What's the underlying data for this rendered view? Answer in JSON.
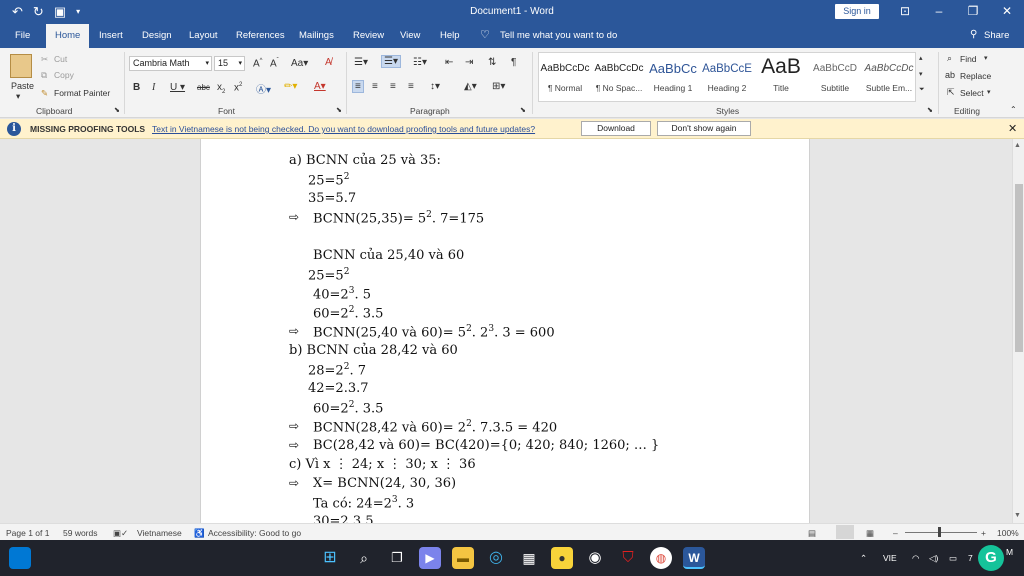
{
  "title_bar": {
    "doc_title": "Document1  -  Word",
    "sign_in": "Sign in"
  },
  "tabs": [
    "File",
    "Home",
    "Insert",
    "Design",
    "Layout",
    "References",
    "Mailings",
    "Review",
    "View",
    "Help"
  ],
  "tell_me": "Tell me what you want to do",
  "share": "Share",
  "clipboard": {
    "paste": "Paste",
    "cut": "Cut",
    "copy": "Copy",
    "format_painter": "Format Painter",
    "label": "Clipboard"
  },
  "font": {
    "name": "Cambria Math",
    "size": "15",
    "label": "Font"
  },
  "paragraph": {
    "label": "Paragraph"
  },
  "styles": {
    "label": "Styles",
    "items": [
      {
        "preview": "AaBbCcDc",
        "name": "¶ Normal"
      },
      {
        "preview": "AaBbCcDc",
        "name": "¶ No Spac..."
      },
      {
        "preview": "AaBbCc",
        "name": "Heading 1"
      },
      {
        "preview": "AaBbCcE",
        "name": "Heading 2"
      },
      {
        "preview": "AaB",
        "name": "Title"
      },
      {
        "preview": "AaBbCcD",
        "name": "Subtitle"
      },
      {
        "preview": "AaBbCcDc",
        "name": "Subtle Em..."
      }
    ]
  },
  "editing": {
    "find": "Find",
    "replace": "Replace",
    "select": "Select",
    "label": "Editing"
  },
  "infobar": {
    "title": "MISSING PROOFING TOOLS",
    "message": "Text in Vietnamese is not being checked. Do you want to download proofing tools and future updates?",
    "download": "Download",
    "dont_show": "Don't show again"
  },
  "document": {
    "lines": [
      "a) BCNN của 25 và 35:",
      "25=5",
      "35=5.7",
      "BCNN(25,35)= 5",
      "BCNN của 25,40 và 60",
      "25=5",
      "40=2",
      "60=2",
      "BCNN(25,40 và 60)= 5",
      "b) BCNN của 28,42 và 60",
      "28=2",
      "42=2.3.7",
      "60=2",
      "BCNN(28,42 và 60)= 2",
      "BC(28,42 và 60)= BC(420)={0; 420; 840; 1260; … }",
      "c) Vì x ⋮ 24; x ⋮ 30; x ⋮ 36",
      "X= BCNN(24, 30, 36)",
      "Ta có: 24=2",
      "30=2.3.5"
    ]
  },
  "status": {
    "page": "Page 1 of 1",
    "words": "59 words",
    "language": "Vietnamese",
    "accessibility": "Accessibility: Good to go",
    "zoom": "100%"
  },
  "taskbar": {
    "lang": "VIE",
    "time": "7",
    "ampm": "M"
  }
}
